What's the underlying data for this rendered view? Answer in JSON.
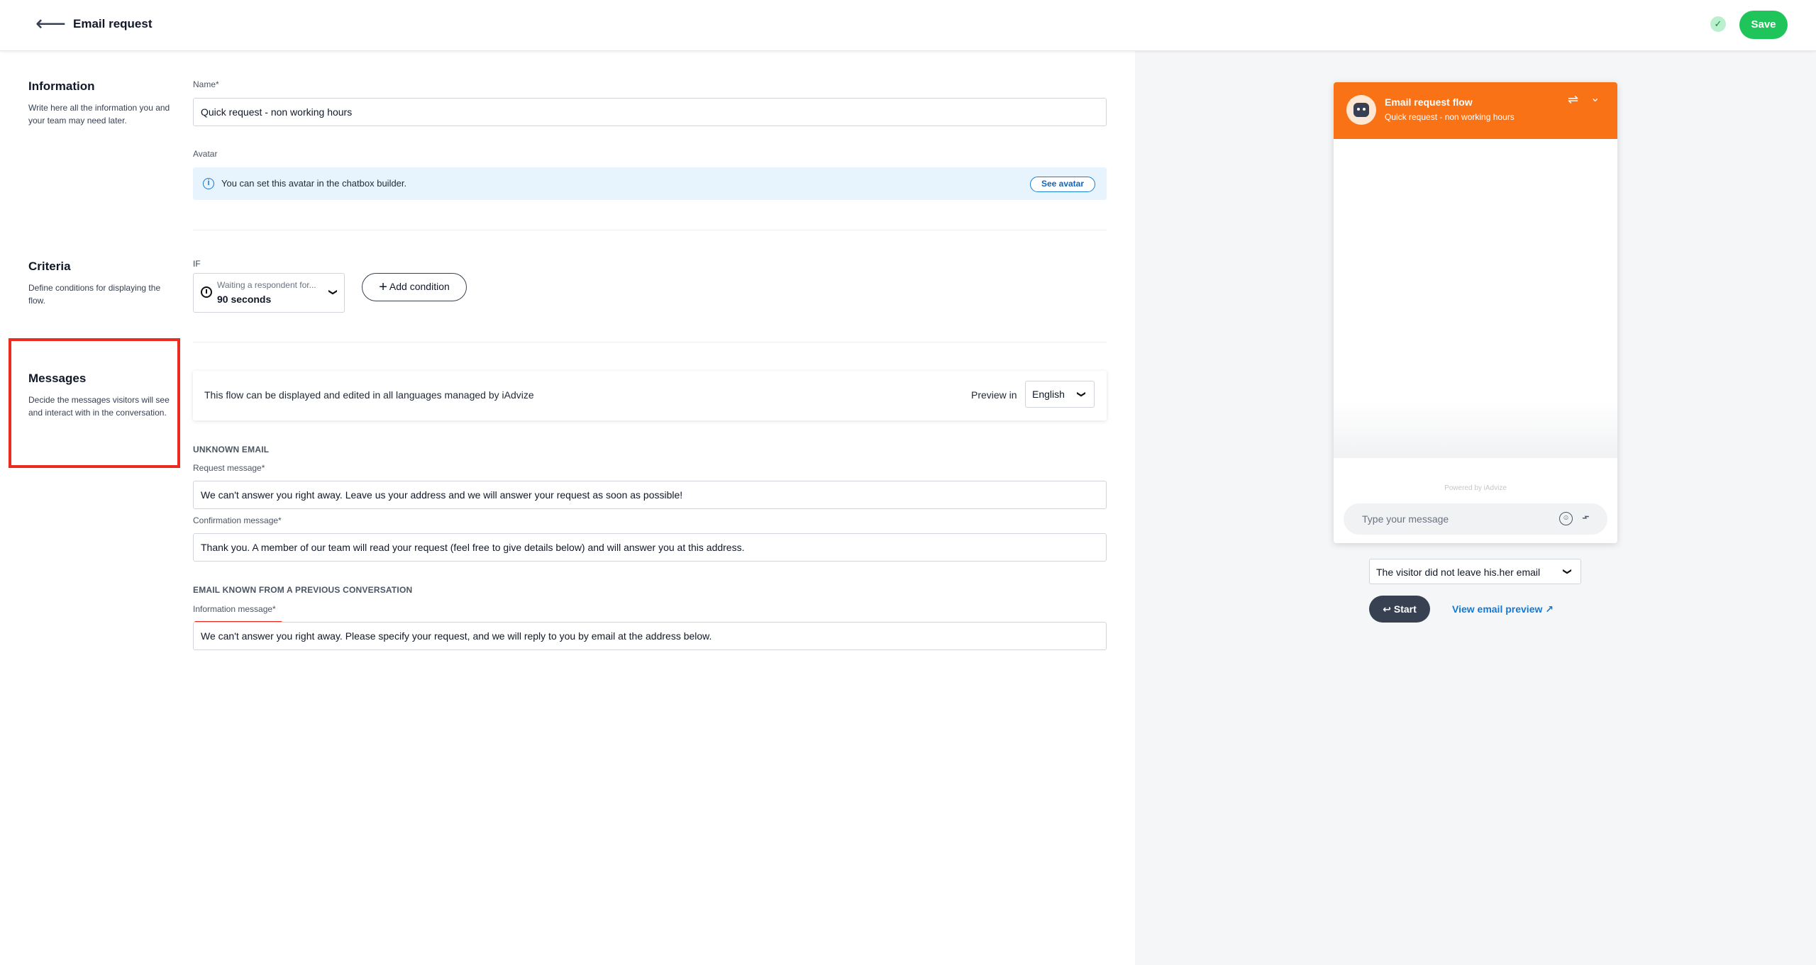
{
  "header": {
    "back_icon": "arrow-left-icon",
    "title": "Email request",
    "save_label": "Save",
    "status_icon": "check-circle-icon"
  },
  "information": {
    "title": "Information",
    "description": "Write here all the information you and your team may need later.",
    "name_label": "Name*",
    "name_value": "Quick request - non working hours",
    "avatar_label": "Avatar",
    "avatar_info": "You can set this avatar in the chatbox builder.",
    "see_avatar_label": "See avatar"
  },
  "criteria": {
    "title": "Criteria",
    "description": "Define conditions for displaying the flow.",
    "if_label": "IF",
    "condition_hint": "Waiting a respondent for...",
    "condition_value": "90 seconds",
    "add_condition_label": "Add condition"
  },
  "messages": {
    "title": "Messages",
    "description": "Decide the messages visitors will see and interact with in the conversation.",
    "language_info": "This flow can be displayed and edited in all languages managed by iAdvize",
    "preview_in_label": "Preview in",
    "preview_language": "English",
    "unknown_email_title": "UNKNOWN EMAIL",
    "request_label": "Request message*",
    "request_value": "We can't answer you right away. Leave us your address and we will answer your request as soon as possible!",
    "confirmation_label": "Confirmation message*",
    "confirmation_value": "Thank you. A member of our team will read your request (feel free to give details below) and will answer you at this address.",
    "known_email_title": "EMAIL KNOWN FROM A PREVIOUS CONVERSATION",
    "information_label": "Information message*",
    "information_value": "We can't answer you right away. Please specify your request, and we will reply to you by email at the address below."
  },
  "preview": {
    "chat_title": "Email request flow",
    "chat_subtitle": "Quick request - non working hours",
    "powered_by": "Powered by iAdvize",
    "input_placeholder": "Type your message",
    "scenario_value": "The visitor did not leave his.her email",
    "start_label": "Start",
    "view_preview_label": "View email preview",
    "accent_color": "#f97316"
  }
}
